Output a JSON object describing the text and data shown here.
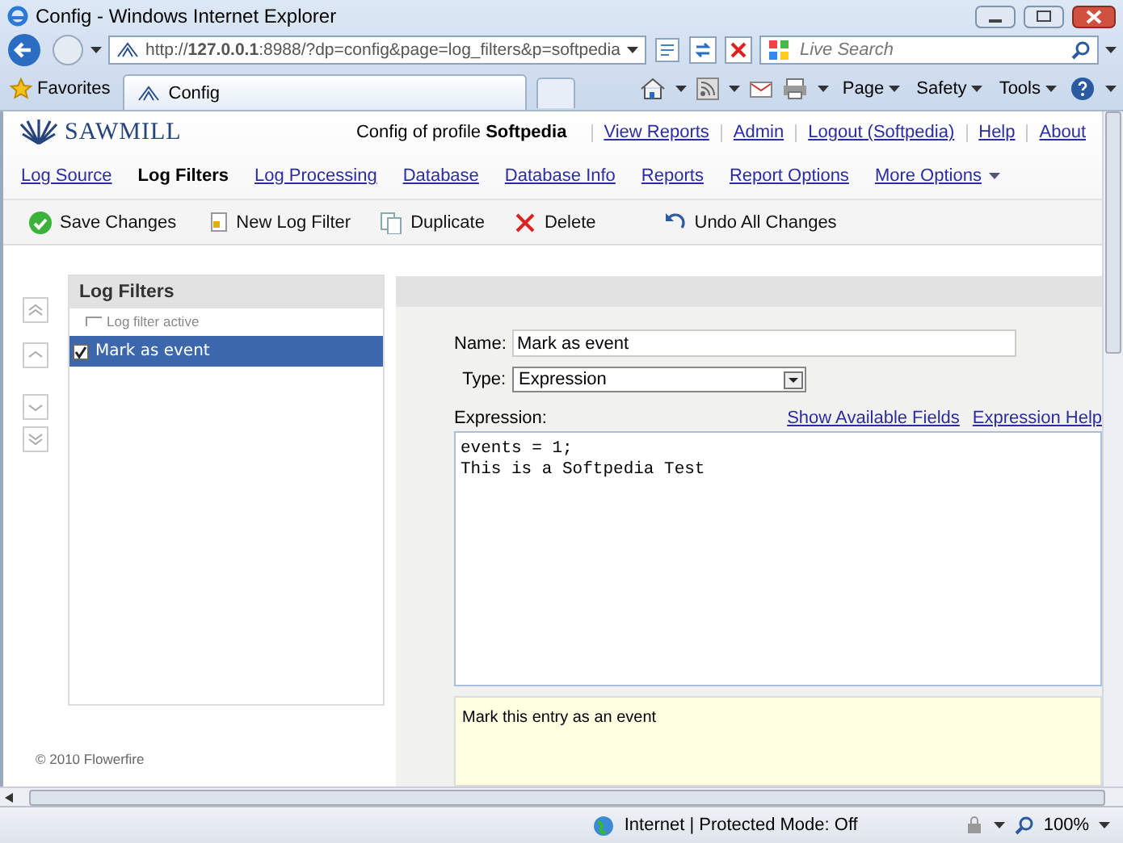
{
  "window": {
    "title": "Config - Windows Internet Explorer"
  },
  "address_bar": {
    "url": "http://**127.0.0.1**:8988/?dp=config&page=log_filters&p=softpedia"
  },
  "search": {
    "placeholder": "Live Search"
  },
  "favorites": {
    "label": "Favorites"
  },
  "browser_tab": {
    "label": "Config"
  },
  "command_bar": [
    {
      "label": "Page"
    },
    {
      "label": "Safety"
    },
    {
      "label": "Tools"
    }
  ],
  "header": {
    "logo": "SAWMILL",
    "profile_label": "Config of profile",
    "profile": "Softpedia",
    "links": [
      "View Reports",
      "Admin",
      "Logout (Softpedia)",
      "Help",
      "About"
    ]
  },
  "nav": [
    {
      "label": "Log Source",
      "selected": false
    },
    {
      "label": "Log Filters",
      "selected": true
    },
    {
      "label": "Log Processing",
      "selected": false
    },
    {
      "label": "Database",
      "selected": false
    },
    {
      "label": "Database Info",
      "selected": false
    },
    {
      "label": "Reports",
      "selected": false
    },
    {
      "label": "Report Options",
      "selected": false
    },
    {
      "label": "More Options",
      "selected": false,
      "kind": "menu"
    }
  ],
  "toolbar": [
    {
      "label": "Save Changes",
      "kind": "save"
    },
    {
      "label": "New Log Filter",
      "kind": "new"
    },
    {
      "label": "Duplicate",
      "kind": "duplicate"
    },
    {
      "label": "Delete",
      "kind": "delete"
    },
    {
      "label": "Undo All Changes",
      "kind": "undo"
    }
  ],
  "filters": {
    "title": "Log Filters",
    "column_hint": "Log filter active",
    "items": [
      {
        "label": "Mark as event",
        "checked": true,
        "selected": true
      }
    ]
  },
  "footer": "© 2010 Flowerfire",
  "form": {
    "name_label": "Name:",
    "name_value": "Mark as event",
    "type_label": "Type:",
    "type_value": "Expression",
    "expression_label": "Expression:",
    "links": [
      "Show Available Fields",
      "Expression Help"
    ],
    "expression": [
      "events = 1;",
      "This is a Softpedia Test"
    ],
    "comment": "Mark this entry as an event"
  },
  "status_bar": {
    "zone": "Internet | Protected Mode: Off",
    "zoom": "100%"
  }
}
